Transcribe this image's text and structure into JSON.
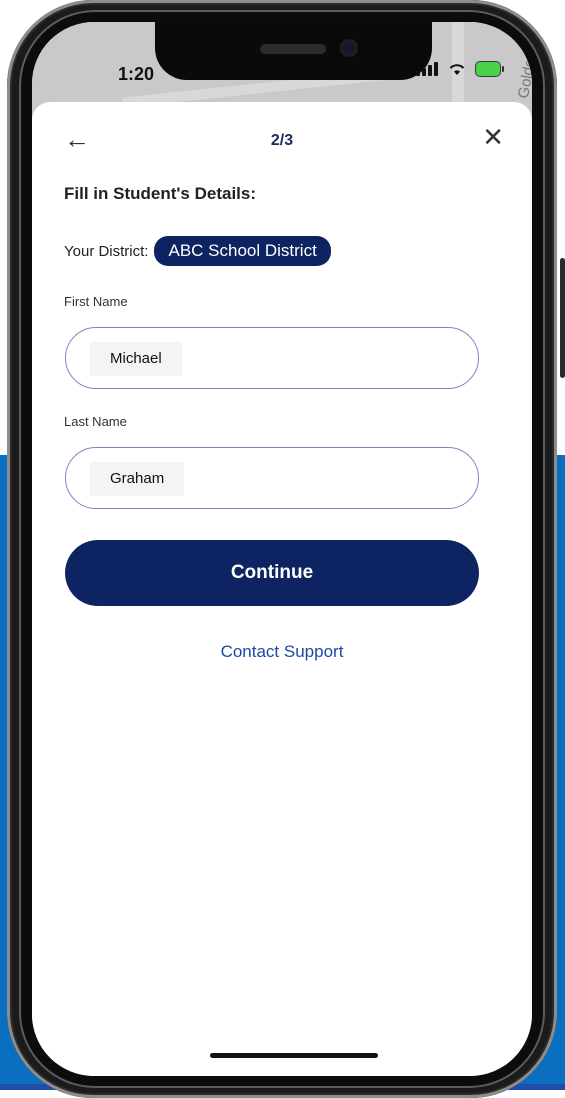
{
  "status_bar": {
    "time": "1:20",
    "battery_color": "#4ad04a"
  },
  "map": {
    "label": "Goldenro"
  },
  "nav": {
    "step": "2/3",
    "back_icon": "arrow-left-icon",
    "close_icon": "close-icon"
  },
  "form": {
    "heading": "Fill in Student's Details:",
    "district_label": "Your District:",
    "district_name": "ABC School District",
    "first_name_label": "First Name",
    "first_name_value": "Michael",
    "last_name_label": "Last Name",
    "last_name_value": "Graham",
    "continue_label": "Continue",
    "support_label": "Contact Support"
  },
  "colors": {
    "primary": "#0e2462",
    "link": "#1d4aa3",
    "input_border": "#7a85c8",
    "background_blue": "#0a6fc0"
  }
}
